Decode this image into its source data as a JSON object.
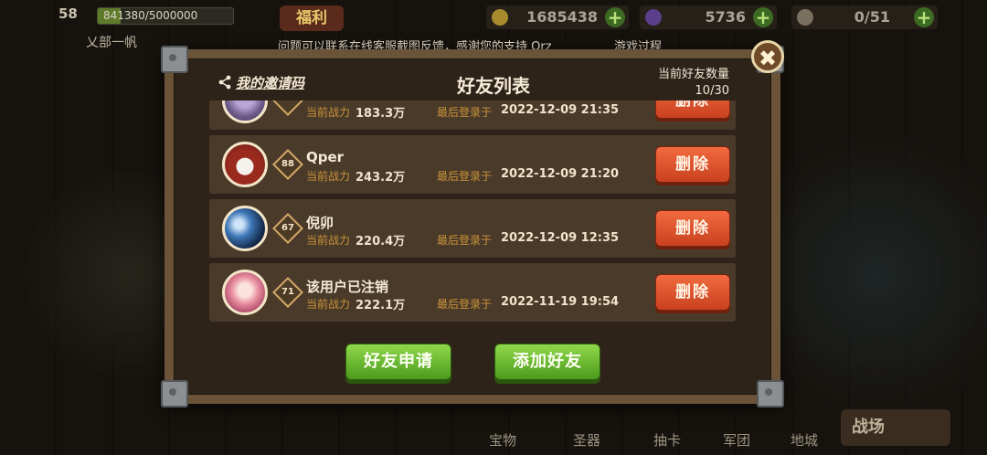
{
  "hud": {
    "level": "58",
    "exp_text": "841380/5000000",
    "exp_progress": 0.168,
    "guild_name": "乂部一帆",
    "welfare_label": "福利",
    "gold": "1685438",
    "gems": "5736",
    "people": "0/51",
    "plus": "+"
  },
  "notice": {
    "text": "问题可以联系在线客服截图反馈，感谢您的支持 Orz",
    "right_text": "游戏过程"
  },
  "modal": {
    "invite_label": "我的邀请码",
    "title": "好友列表",
    "friend_count_label": "当前好友数量",
    "friend_count_value": "10/30",
    "close_label": "✖",
    "power_label": "当前战力",
    "last_login_label": "最后登录于",
    "delete_label": "删除",
    "apply_button": "好友申请",
    "add_button": "添加好友"
  },
  "friends": [
    {
      "name": "",
      "level": "",
      "power": "183.3万",
      "last_login": "2022-12-09 21:35",
      "avatar": "purple-character"
    },
    {
      "name": "Qper",
      "level": "88",
      "power": "243.2万",
      "last_login": "2022-12-09 21:20",
      "avatar": "husky-dog"
    },
    {
      "name": "倪卯",
      "level": "67",
      "power": "220.4万",
      "last_login": "2022-12-09 12:35",
      "avatar": "planet-earth"
    },
    {
      "name": "该用户已注销",
      "level": "71",
      "power": "222.1万",
      "last_login": "2022-11-19 19:54",
      "avatar": "anime-girl-pink"
    }
  ],
  "bottom_tabs": [
    "宝物",
    "圣器",
    "抽卡",
    "军团",
    "地城"
  ],
  "battle_label": "战场"
}
